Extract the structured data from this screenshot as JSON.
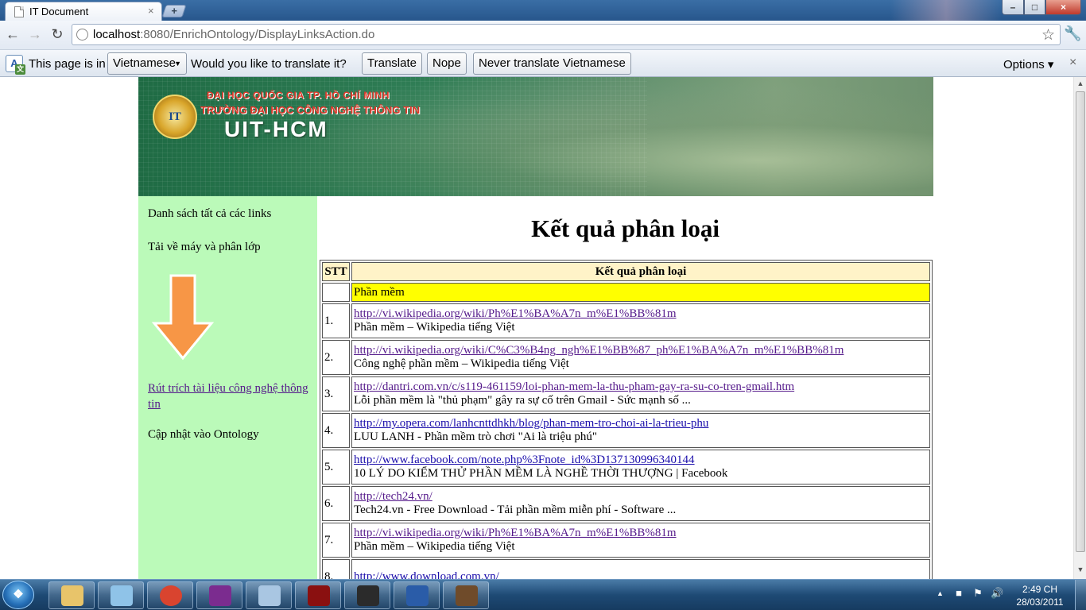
{
  "browser": {
    "tab_title": "IT Document",
    "tab_close": "×",
    "new_tab": "+",
    "url_host": "localhost",
    "url_path": ":8080/EnrichOntology/DisplayLinksAction.do",
    "icons": [
      "back-icon",
      "forward-icon",
      "reload-icon",
      "globe-icon",
      "star-icon",
      "wrench-icon"
    ]
  },
  "window_controls": {
    "minimize": "–",
    "maximize": "□",
    "close": "×"
  },
  "translate_bar": {
    "prefix": "This page is in",
    "language": "Vietnamese",
    "question": "Would you like to translate it?",
    "translate_label": "Translate",
    "nope_label": "Nope",
    "never_label": "Never translate Vietnamese",
    "options_label": "Options ▾",
    "close": "×"
  },
  "banner": {
    "logo_text": "IT",
    "line1": "ĐẠI HỌC QUỐC GIA TP. HỒ CHÍ MINH",
    "line2": "TRƯỜNG ĐẠI HỌC CÔNG NGHỆ THÔNG TIN",
    "name": "UIT-HCM"
  },
  "sidebar": {
    "item1": "Danh sách tất cả các links",
    "item2": "Tải về máy và phân lớp",
    "link": "Rút trích tài liệu công nghệ thông tin",
    "item4": "Cập nhật vào Ontology"
  },
  "main": {
    "title": "Kết quả phân loại",
    "col_stt": "STT",
    "col_result": "Kết quả phân loại",
    "category": "Phần mềm",
    "rows": [
      {
        "num": "1.",
        "url": "http://vi.wikipedia.org/wiki/Ph%E1%BA%A7n_m%E1%BB%81m ",
        "desc": "Phần mềm – Wikipedia tiếng Việt"
      },
      {
        "num": "2.",
        "url": "http://vi.wikipedia.org/wiki/C%C3%B4ng_ngh%E1%BB%87_ph%E1%BA%A7n_m%E1%BB%81m ",
        "desc": "Công nghệ phần mềm – Wikipedia tiếng Việt"
      },
      {
        "num": "3.",
        "url": "http://dantri.com.vn/c/s119-461159/loi-phan-mem-la-thu-pham-gay-ra-su-co-tren-gmail.htm ",
        "desc": "Lỗi phần mềm là \"thủ phạm\" gây ra sự cố trên Gmail - Sức mạnh số ..."
      },
      {
        "num": "4.",
        "url": "http://my.opera.com/lanhcnttdhkh/blog/phan-mem-tro-choi-ai-la-trieu-phu ",
        "desc": "LUU LANH - Phần mềm trò chơi \"Ai là triệu phú\""
      },
      {
        "num": "5.",
        "url": "http://www.facebook.com/note.php%3Fnote_id%3D137130996340144 ",
        "desc": "10 LÝ DO KIỂM THỬ PHẦN MỀM LÀ NGHỀ THỜI THƯỢNG | Facebook"
      },
      {
        "num": "6.",
        "url": "http://tech24.vn/ ",
        "desc": "Tech24.vn - Free Download - Tải phần mềm miễn phí - Software ..."
      },
      {
        "num": "7.",
        "url": "http://vi.wikipedia.org/wiki/Ph%E1%BA%A7n_m%E1%BB%81m ",
        "desc": "Phần mềm – Wikipedia tiếng Việt"
      },
      {
        "num": "8.",
        "url": "http://www.download.com.vn/ ",
        "desc": ""
      }
    ]
  },
  "taskbar": {
    "apps": [
      "explorer-icon",
      "notepad-icon",
      "chrome-icon",
      "yahoo-messenger-icon",
      "virtualbox-icon",
      "game-icon",
      "solitaire-icon",
      "word-icon",
      "crown-app-icon"
    ],
    "time": "2:49 CH",
    "date": "28/03/2011"
  },
  "colors": {
    "sidebar_bg": "#bbfab9",
    "category_bg": "#ffff00",
    "header_bg": "#fff3c8",
    "link": "#1a0dab",
    "visited": "#551a8b"
  }
}
